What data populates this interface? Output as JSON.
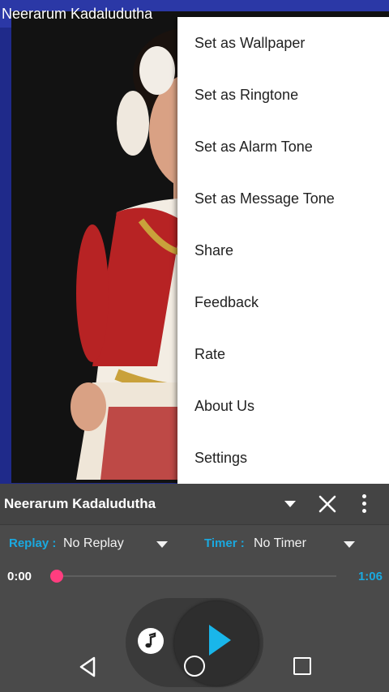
{
  "app": {
    "title": "Neerarum Kadaludutha"
  },
  "menu": {
    "items": [
      {
        "label": "Set as Wallpaper"
      },
      {
        "label": "Set as Ringtone"
      },
      {
        "label": "Set as Alarm Tone"
      },
      {
        "label": "Set as Message Tone"
      },
      {
        "label": "Share"
      },
      {
        "label": "Feedback"
      },
      {
        "label": "Rate"
      },
      {
        "label": "About Us"
      },
      {
        "label": "Settings"
      }
    ]
  },
  "player": {
    "title": "Neerarum Kadaludutha",
    "replay_label": "Replay :",
    "replay_value": "No Replay",
    "timer_label": "Timer :",
    "timer_value": "No Timer",
    "current_time": "0:00",
    "total_time": "1:06",
    "progress": 0.0
  },
  "colors": {
    "accent_blue": "#1aa9e0",
    "seek_pink": "#ff3d7f",
    "status_bar": "#2b38a6"
  },
  "icons": [
    "chevron-down-icon",
    "close-icon",
    "more-vert-icon",
    "music-note-icon",
    "play-icon",
    "back-icon",
    "home-icon",
    "recent-apps-icon"
  ]
}
